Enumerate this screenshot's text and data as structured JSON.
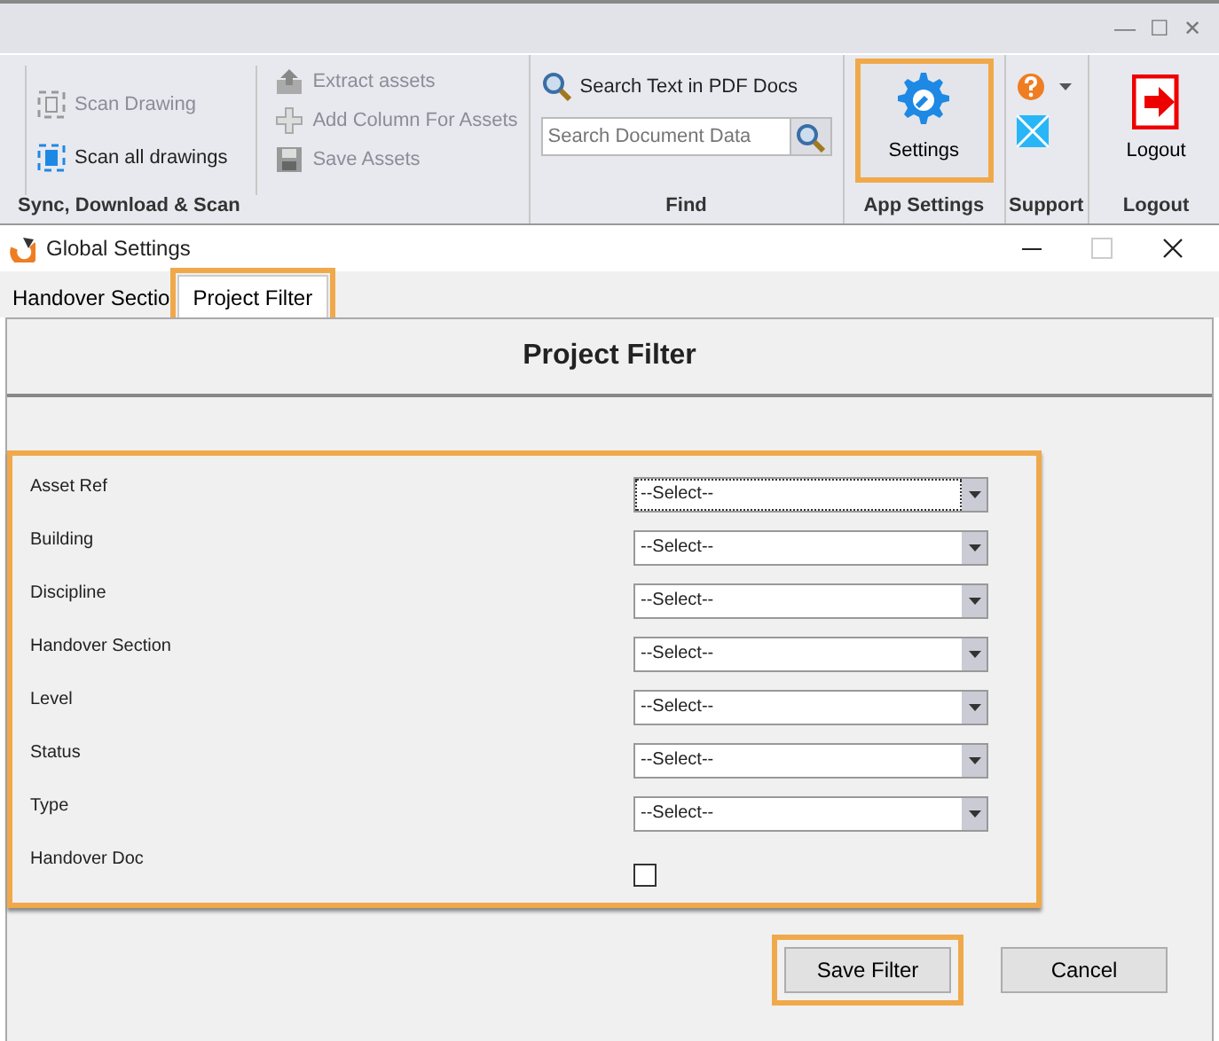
{
  "ribbon": {
    "window_controls": [
      "—",
      "☐",
      "✕"
    ],
    "groups": [
      {
        "label": "Sync, Download & Scan",
        "columns": [
          [
            {
              "kind": "scan",
              "label": "Scan Drawing",
              "disabled": true
            },
            {
              "kind": "scan",
              "label": "Scan all drawings",
              "disabled": false
            }
          ],
          [
            {
              "kind": "extract",
              "label": "Extract assets",
              "disabled": true
            },
            {
              "kind": "add",
              "label": "Add Column For Assets",
              "disabled": true
            },
            {
              "kind": "save",
              "label": "Save Assets",
              "disabled": true
            }
          ]
        ]
      },
      {
        "label": "Find",
        "kind": "find",
        "search_button": "Search Text in PDF Docs",
        "search": {
          "placeholder": "Search Document Data"
        }
      },
      {
        "label": "App Settings",
        "kind": "settings",
        "button": "Settings",
        "highlighted": true
      },
      {
        "label": "Support",
        "kind": "support"
      },
      {
        "label": "Logout",
        "kind": "logout",
        "button": "Logout"
      }
    ]
  },
  "dialog": {
    "title": "Global Settings",
    "tabs": [
      {
        "label": "Handover Sectio",
        "selected": false,
        "highlighted": false
      },
      {
        "label": "Project Filter",
        "selected": true,
        "highlighted": true
      }
    ],
    "heading": "Project Filter",
    "form": {
      "highlighted": true,
      "fields": [
        {
          "kind": "select",
          "label": "Asset Ref",
          "value": "--Select--",
          "focused": true
        },
        {
          "kind": "select",
          "label": "Building",
          "value": "--Select--",
          "focused": false
        },
        {
          "kind": "select",
          "label": "Discipline",
          "value": "--Select--",
          "focused": false
        },
        {
          "kind": "select",
          "label": "Handover Section",
          "value": "--Select--",
          "focused": false
        },
        {
          "kind": "select",
          "label": "Level",
          "value": "--Select--",
          "focused": false
        },
        {
          "kind": "select",
          "label": "Status",
          "value": "--Select--",
          "focused": false
        },
        {
          "kind": "select",
          "label": "Type",
          "value": "--Select--",
          "focused": false
        },
        {
          "kind": "checkbox",
          "label": "Handover Doc",
          "checked": false
        }
      ]
    },
    "buttons": [
      {
        "label": "Save Filter",
        "highlighted": true
      },
      {
        "label": "Cancel",
        "highlighted": false
      }
    ]
  }
}
